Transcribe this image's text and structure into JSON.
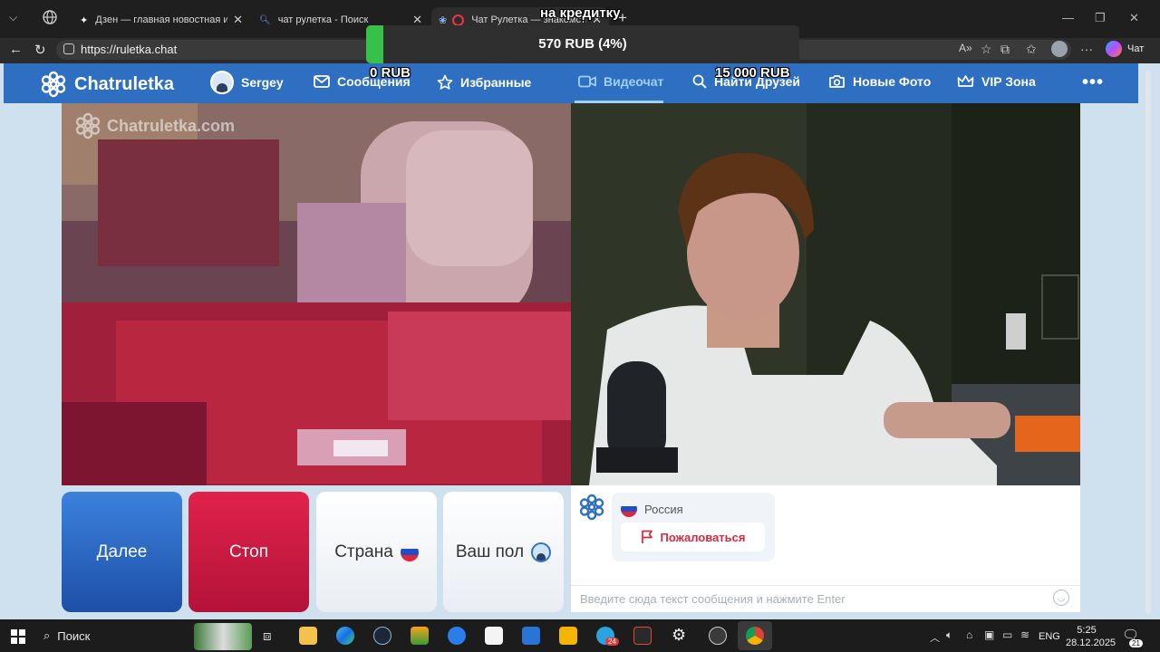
{
  "browser": {
    "tabs": [
      {
        "title": "Дзен — главная новостная инфо"
      },
      {
        "title": "чат рулетка - Поиск"
      },
      {
        "title": "Чат Рулетка — знакомства в"
      }
    ],
    "url": "https://ruletka.chat",
    "copilot_label": "Чат"
  },
  "overlay": {
    "label": "на кредитку",
    "progress": "570 RUB (4%)",
    "progress_fraction": 0.04,
    "min_value": "0 RUB",
    "max_value": "15 000 RUB",
    "progress_color": "#37c04a"
  },
  "site": {
    "brand": "Chatruletka",
    "watermark": "Chatruletka.com",
    "nav": {
      "user": "Sergey",
      "messages": "Сообщения",
      "favorites": "Избранные",
      "videochat": "Видеочат",
      "find_friends": "Найти Друзей",
      "new_photos": "Новые Фото",
      "vip": "VIP Зона"
    },
    "accent": "#2f6fc1"
  },
  "controls": {
    "next": "Далее",
    "stop": "Стоп",
    "country": "Страна",
    "gender": "Ваш пол"
  },
  "chat": {
    "partner_country": "Россия",
    "report": "Пожаловаться",
    "placeholder": "Введите сюда текст сообщения и нажмите Enter"
  },
  "taskbar": {
    "search": "Поиск",
    "lang": "ENG",
    "time": "5:25",
    "date": "28.12.2025",
    "notifications": "21",
    "telegram_badge": "24"
  }
}
